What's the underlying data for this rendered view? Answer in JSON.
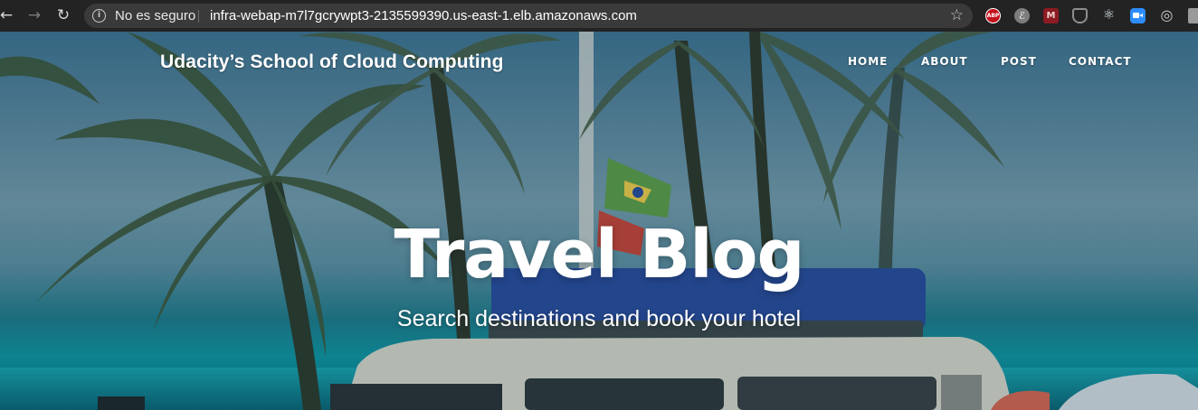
{
  "browser": {
    "security_label": "No es seguro",
    "url": "infra-webap-m7l7gcrywpt3-2135599390.us-east-1.elb.amazonaws.com",
    "icons": [
      "back-icon",
      "forward-icon",
      "reload-icon",
      "info-icon",
      "bookmark-star-icon"
    ],
    "extensions": [
      {
        "name": "adblock-plus-extension-icon",
        "label": "ABP",
        "color": "#c4101b"
      },
      {
        "name": "grey-circle-extension-icon",
        "label": "ℰ",
        "color": "#7d7d7d"
      },
      {
        "name": "red-m-extension-icon",
        "label": "M",
        "color": "#8d1b23"
      },
      {
        "name": "shield-extension-icon",
        "label": "",
        "color": "#8e8e8e"
      },
      {
        "name": "react-devtools-icon",
        "label": "⚛",
        "color": "#61dafb"
      },
      {
        "name": "zoom-extension-icon",
        "label": "",
        "color": "#2d8cff"
      },
      {
        "name": "circle-target-extension-icon",
        "label": "◎",
        "color": "#bbbbbb"
      },
      {
        "name": "puzzle-extension-icon",
        "label": "",
        "color": "#9a9a9a"
      }
    ]
  },
  "site": {
    "brand": "Udacity’s School of Cloud Computing",
    "nav": [
      {
        "label": "HOME"
      },
      {
        "label": "ABOUT"
      },
      {
        "label": "POST"
      },
      {
        "label": "CONTACT"
      }
    ],
    "hero": {
      "title": "Travel Blog",
      "subtitle": "Search destinations and book your hotel"
    }
  },
  "colors": {
    "browser_bar": "#232323",
    "omnibox": "#3a3a3a",
    "hero_sky": "#6e9bb1",
    "hero_sea": "#0f9aa6"
  }
}
